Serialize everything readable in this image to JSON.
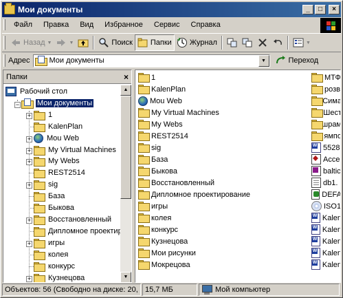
{
  "window": {
    "title": "Мои документы"
  },
  "title_buttons": {
    "minimize": "_",
    "maximize": "□",
    "close": "×"
  },
  "menu": [
    "Файл",
    "Правка",
    "Вид",
    "Избранное",
    "Сервис",
    "Справка"
  ],
  "toolbar": {
    "back_label": "Назад",
    "search_label": "Поиск",
    "folders_label": "Папки",
    "history_label": "Журнал"
  },
  "address": {
    "label": "Адрес",
    "value": "Мои документы",
    "go_label": "Переход"
  },
  "folders_pane": {
    "title": "Папки",
    "close": "×",
    "tree": [
      {
        "label": "Рабочий стол",
        "icon": "desktop-icon",
        "level": 0
      },
      {
        "label": "Мои документы",
        "icon": "my-documents-icon",
        "level": 1,
        "selected": true,
        "expander": "−"
      },
      {
        "label": "1",
        "icon": "folder-icon",
        "level": 2,
        "expander": "+"
      },
      {
        "label": "KalenPlan",
        "icon": "folder-icon",
        "level": 2
      },
      {
        "label": "Mou Web",
        "icon": "web-folder-icon",
        "level": 2,
        "expander": "+"
      },
      {
        "label": "My Virtual Machines",
        "icon": "folder-icon",
        "level": 2,
        "expander": "+"
      },
      {
        "label": "My Webs",
        "icon": "folder-icon",
        "level": 2,
        "expander": "+"
      },
      {
        "label": "REST2514",
        "icon": "folder-icon",
        "level": 2
      },
      {
        "label": "sig",
        "icon": "folder-icon",
        "level": 2,
        "expander": "+"
      },
      {
        "label": "База",
        "icon": "folder-icon",
        "level": 2
      },
      {
        "label": "Быкова",
        "icon": "folder-icon",
        "level": 2
      },
      {
        "label": "Восстановленный",
        "icon": "folder-icon",
        "level": 2,
        "expander": "+"
      },
      {
        "label": "Дипломное проектирование",
        "icon": "folder-icon",
        "level": 2
      },
      {
        "label": "игры",
        "icon": "folder-icon",
        "level": 2,
        "expander": "+"
      },
      {
        "label": "колея",
        "icon": "folder-icon",
        "level": 2
      },
      {
        "label": "конкурс",
        "icon": "folder-icon",
        "level": 2
      },
      {
        "label": "Кузнецова",
        "icon": "folder-icon",
        "level": 2,
        "expander": "+"
      }
    ]
  },
  "files_col1": [
    {
      "label": "1",
      "icon": "folder-icon"
    },
    {
      "label": "KalenPlan",
      "icon": "folder-icon"
    },
    {
      "label": "Mou Web",
      "icon": "web-folder-icon"
    },
    {
      "label": "My Virtual Machines",
      "icon": "folder-icon"
    },
    {
      "label": "My Webs",
      "icon": "folder-icon"
    },
    {
      "label": "REST2514",
      "icon": "folder-icon"
    },
    {
      "label": "sig",
      "icon": "folder-icon"
    },
    {
      "label": "База",
      "icon": "folder-icon"
    },
    {
      "label": "Быкова",
      "icon": "folder-icon"
    },
    {
      "label": "Восстановленный",
      "icon": "folder-icon"
    },
    {
      "label": "Дипломное проектирование",
      "icon": "folder-icon"
    },
    {
      "label": "игры",
      "icon": "folder-icon"
    },
    {
      "label": "колея",
      "icon": "folder-icon"
    },
    {
      "label": "конкурс",
      "icon": "folder-icon"
    },
    {
      "label": "Кузнецова",
      "icon": "folder-icon"
    },
    {
      "label": "Мои рисунки",
      "icon": "my-pictures-icon"
    },
    {
      "label": "Мокрецова",
      "icon": "folder-icon"
    }
  ],
  "files_col2": [
    {
      "label": "МТФ",
      "icon": "folder-icon"
    },
    {
      "label": "розв",
      "icon": "folder-icon"
    },
    {
      "label": "Сима",
      "icon": "folder-icon"
    },
    {
      "label": "Шест",
      "icon": "folder-icon"
    },
    {
      "label": "шрам",
      "icon": "folder-icon"
    },
    {
      "label": "ямпо",
      "icon": "folder-icon"
    },
    {
      "label": "5528",
      "icon": "word-document-icon"
    },
    {
      "label": "Acce",
      "icon": "access-document-icon"
    },
    {
      "label": "baltic",
      "icon": "powerpoint-document-icon"
    },
    {
      "label": "db1.",
      "icon": "text-document-icon"
    },
    {
      "label": "DEFA",
      "icon": "generic-document-icon"
    },
    {
      "label": "ISO1",
      "icon": "disc-image-icon"
    },
    {
      "label": "Kalen",
      "icon": "word-document-icon"
    },
    {
      "label": "Kalen",
      "icon": "word-document-icon"
    },
    {
      "label": "Kalen",
      "icon": "word-document-icon"
    },
    {
      "label": "Kalen",
      "icon": "word-document-icon"
    },
    {
      "label": "Kalen",
      "icon": "word-document-icon"
    }
  ],
  "status": {
    "objects": "Объектов: 56 (Свободно на диске: 20,",
    "size": "15,7 МБ",
    "location": "Мой компьютер"
  },
  "colors": {
    "titlebar_start": "#0a246a",
    "titlebar_end": "#3a6ea5",
    "selection": "#0a246a",
    "face": "#d4d0c8"
  }
}
